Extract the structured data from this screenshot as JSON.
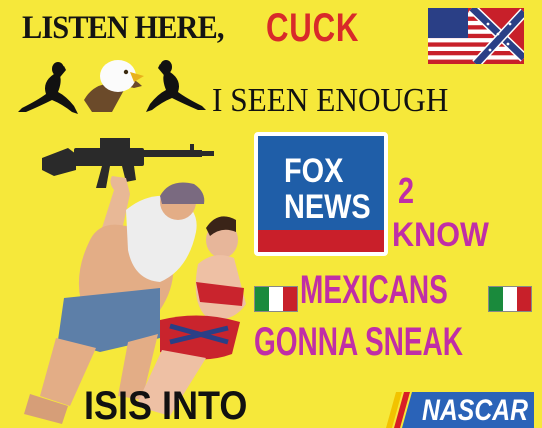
{
  "headline": {
    "black": "LISTEN HERE,",
    "red": "CUCK"
  },
  "line2": "I SEEN ENOUGH",
  "fox_logo": {
    "line1": "FOX",
    "line2": "NEWS"
  },
  "purple": {
    "two": "2",
    "know": "KNOW",
    "mexicans": "MEXICANS",
    "gonna": "GONNA SNEAK"
  },
  "bottom": {
    "isis": "ISIS INTO"
  },
  "nascar_logo": "NASCAR",
  "colors": {
    "background": "#f6e83a",
    "red_text": "#d82a2a",
    "purple_text": "#c02ea7",
    "fox_blue": "#1f5ea8",
    "fox_red": "#c91f2a"
  },
  "icons": [
    "us-confederate-flag-icon",
    "silhouette-woman-icon",
    "bald-eagle-icon",
    "rifle-icon",
    "mexican-flag-icon",
    "nascar-logo-icon"
  ]
}
